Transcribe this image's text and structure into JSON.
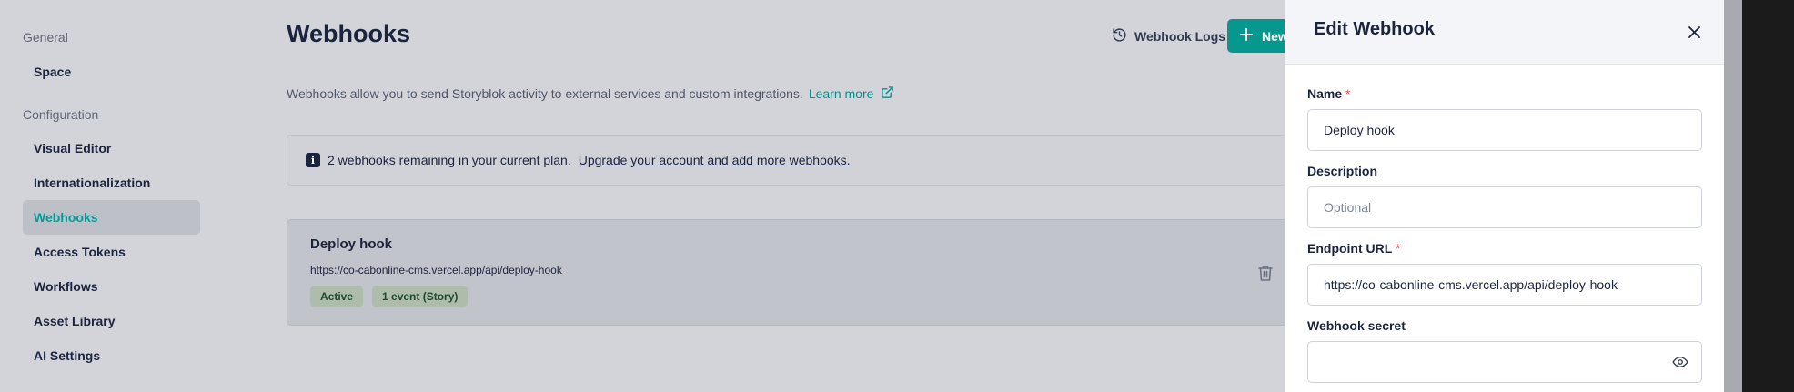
{
  "sidebar": {
    "groups": [
      {
        "label": "General",
        "items": [
          {
            "label": "Space"
          }
        ]
      },
      {
        "label": "Configuration",
        "items": [
          {
            "label": "Visual Editor"
          },
          {
            "label": "Internationalization"
          },
          {
            "label": "Webhooks"
          },
          {
            "label": "Access Tokens"
          },
          {
            "label": "Workflows"
          },
          {
            "label": "Asset Library"
          },
          {
            "label": "AI Settings"
          }
        ]
      }
    ],
    "active_item": "Webhooks"
  },
  "main": {
    "title": "Webhooks",
    "logs_label": "Webhook Logs",
    "new_label": "New",
    "intro_text": "Webhooks allow you to send Storyblok activity to external services and custom integrations.",
    "learn_more": "Learn more",
    "notice": {
      "icon": "i",
      "text": "2 webhooks remaining in your current plan.",
      "link": "Upgrade your account and add more webhooks."
    },
    "hooks": [
      {
        "name": "Deploy hook",
        "url": "https://co-cabonline-cms.vercel.app/api/deploy-hook",
        "badges": [
          "Active",
          "1 event  (Story)"
        ]
      }
    ]
  },
  "drawer": {
    "title": "Edit Webhook",
    "fields": {
      "name": {
        "label": "Name",
        "required": "*",
        "value": "Deploy hook"
      },
      "description": {
        "label": "Description",
        "placeholder": "Optional"
      },
      "endpoint": {
        "label": "Endpoint URL",
        "required": "*",
        "value": "https://co-cabonline-cms.vercel.app/api/deploy-hook"
      },
      "secret": {
        "label": "Webhook secret",
        "value": ""
      }
    }
  },
  "colors": {
    "accent": "#06988f",
    "accent_text": "#009e99",
    "required": "#e4535a",
    "badge_bg": "#aebcab"
  },
  "icons": [
    "history-icon",
    "plus-icon",
    "external-link-icon",
    "info-icon",
    "trash-icon",
    "close-icon",
    "eye-icon"
  ]
}
